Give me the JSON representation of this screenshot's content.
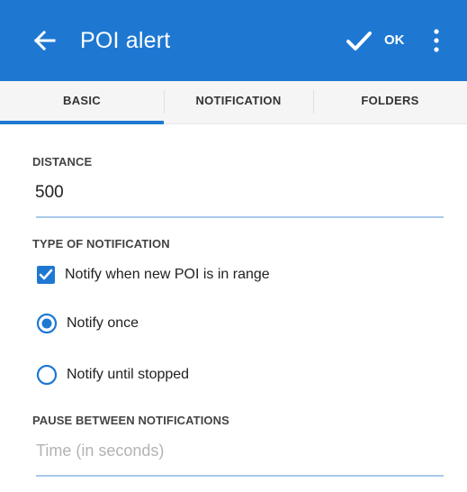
{
  "header": {
    "title": "POI alert",
    "ok_label": "OK",
    "back_icon": "arrow-left-icon",
    "confirm_icon": "check-icon",
    "more_icon": "more-vertical-icon",
    "bar_color": "#1e78d2"
  },
  "tabs": [
    {
      "label": "BASIC",
      "active": true
    },
    {
      "label": "NOTIFICATION",
      "active": false
    },
    {
      "label": "FOLDERS",
      "active": false
    }
  ],
  "form": {
    "distance": {
      "label": "DISTANCE",
      "value": "500"
    },
    "type_of_notification": {
      "label": "TYPE OF NOTIFICATION",
      "checkbox": {
        "label": "Notify when new POI is in range",
        "checked": true
      },
      "radio_options": [
        {
          "label": "Notify once",
          "selected": true
        },
        {
          "label": "Notify until stopped",
          "selected": false
        }
      ]
    },
    "pause": {
      "label": "PAUSE BETWEEN NOTIFICATIONS",
      "placeholder": "Time (in seconds)",
      "value": ""
    }
  }
}
